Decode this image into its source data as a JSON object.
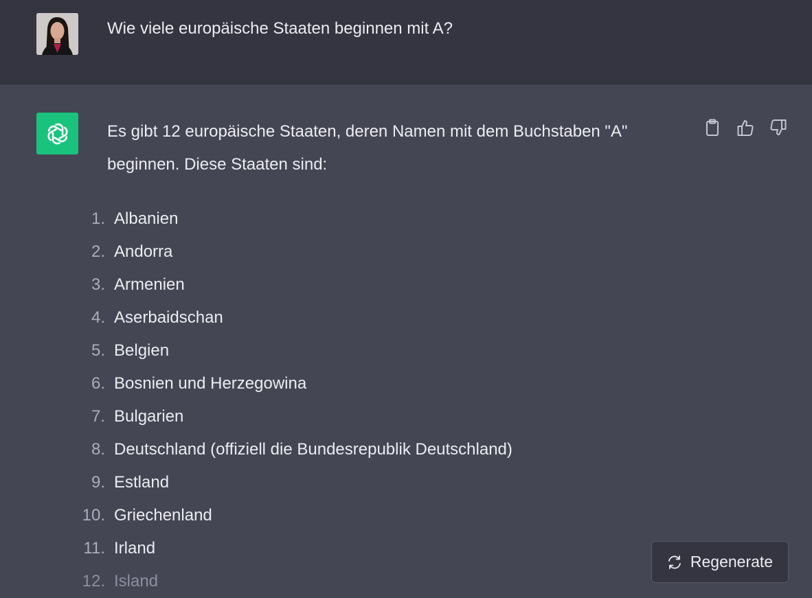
{
  "user_message": {
    "text": "Wie viele europäische Staaten beginnen mit A?",
    "avatar": "user-avatar-photo"
  },
  "assistant_message": {
    "intro": "Es gibt 12 europäische Staaten, deren Namen mit dem Buchstaben \"A\" beginnen. Diese Staaten sind:",
    "list": [
      {
        "num": "1.",
        "text": "Albanien"
      },
      {
        "num": "2.",
        "text": "Andorra"
      },
      {
        "num": "3.",
        "text": "Armenien"
      },
      {
        "num": "4.",
        "text": "Aserbaidschan"
      },
      {
        "num": "5.",
        "text": "Belgien"
      },
      {
        "num": "6.",
        "text": "Bosnien und Herzegowina"
      },
      {
        "num": "7.",
        "text": "Bulgarien"
      },
      {
        "num": "8.",
        "text": "Deutschland (offiziell die Bundesrepublik Deutschland)"
      },
      {
        "num": "9.",
        "text": "Estland"
      },
      {
        "num": "10.",
        "text": "Griechenland"
      },
      {
        "num": "11.",
        "text": "Irland"
      },
      {
        "num": "12.",
        "text": "Island"
      }
    ],
    "actions": [
      "clipboard-icon",
      "thumbs-up-icon",
      "thumbs-down-icon"
    ]
  },
  "regenerate": {
    "label": "Regenerate",
    "icon": "refresh-icon"
  },
  "colors": {
    "user_bg": "#343541",
    "assistant_bg": "#444654",
    "brand_green": "#19c37d"
  }
}
